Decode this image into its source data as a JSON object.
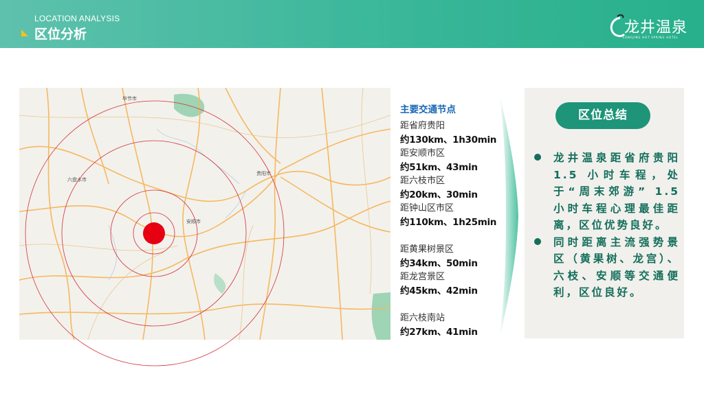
{
  "header": {
    "subtitle_en": "LOCATION ANALYSIS",
    "title": "区位分析",
    "logo_cn": "龙井温泉",
    "logo_en": "LONGJING HOT SPRING HOTEL"
  },
  "map": {
    "labels": [
      "毕节市",
      "六盘水市",
      "安顺市",
      "贵阳市"
    ],
    "colors": {
      "marker": "#e60012",
      "ring": "#d0303a"
    }
  },
  "nodes": {
    "title": "主要交通节点",
    "group1": [
      {
        "label": "距省府贵阳",
        "value": "约130km、1h30min"
      },
      {
        "label": "距安顺市区",
        "value": "约51km、43min"
      },
      {
        "label": "距六枝市区",
        "value": "约20km、30min"
      },
      {
        "label": "距钟山区市区",
        "value": "约110km、1h25min"
      }
    ],
    "group2": [
      {
        "label": "距黄果树景区",
        "value": "约34km、50min"
      },
      {
        "label": "距龙宫景区",
        "value": "约45km、42min"
      }
    ],
    "group3": [
      {
        "label": "距六枝南站",
        "value": "约27km、41min"
      }
    ]
  },
  "summary": {
    "title": "区位总结",
    "bullets": [
      "龙井温泉距省府贵阳 1.5 小时车程，处于“周末郊游” 1.5 小时车程心理最佳距离，区位优势良好。",
      "同时距离主流强势景区（黄果树、龙宫）、六枝、安顺等交通便利，区位良好。"
    ]
  }
}
